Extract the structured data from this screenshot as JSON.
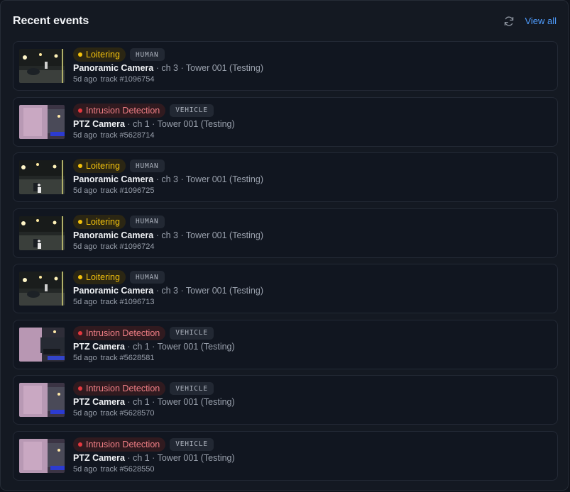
{
  "header": {
    "title": "Recent events",
    "view_all_label": "View all",
    "refresh_icon": "refresh-icon"
  },
  "colors": {
    "loitering": "#f4c20d",
    "intrusion": "#e5383f",
    "link": "#4f9dff"
  },
  "separator": " · ",
  "events": [
    {
      "type": "loiter",
      "event": "Loitering",
      "class": "HUMAN",
      "camera": "Panoramic Camera",
      "channel": "ch 3",
      "site": "Tower 001 (Testing)",
      "time": "5d ago",
      "track": "track #1096754",
      "thumb": "night-car"
    },
    {
      "type": "intrusion",
      "event": "Intrusion Detection",
      "class": "VEHICLE",
      "camera": "PTZ Camera",
      "channel": "ch 1",
      "site": "Tower 001 (Testing)",
      "time": "5d ago",
      "track": "track #5628714",
      "thumb": "ptz-pink"
    },
    {
      "type": "loiter",
      "event": "Loitering",
      "class": "HUMAN",
      "camera": "Panoramic Camera",
      "channel": "ch 3",
      "site": "Tower 001 (Testing)",
      "time": "5d ago",
      "track": "track #1096725",
      "thumb": "night-person"
    },
    {
      "type": "loiter",
      "event": "Loitering",
      "class": "HUMAN",
      "camera": "Panoramic Camera",
      "channel": "ch 3",
      "site": "Tower 001 (Testing)",
      "time": "5d ago",
      "track": "track #1096724",
      "thumb": "night-person"
    },
    {
      "type": "loiter",
      "event": "Loitering",
      "class": "HUMAN",
      "camera": "Panoramic Camera",
      "channel": "ch 3",
      "site": "Tower 001 (Testing)",
      "time": "5d ago",
      "track": "track #1096713",
      "thumb": "night-car"
    },
    {
      "type": "intrusion",
      "event": "Intrusion Detection",
      "class": "VEHICLE",
      "camera": "PTZ Camera",
      "channel": "ch 1",
      "site": "Tower 001 (Testing)",
      "time": "5d ago",
      "track": "track #5628581",
      "thumb": "ptz-car"
    },
    {
      "type": "intrusion",
      "event": "Intrusion Detection",
      "class": "VEHICLE",
      "camera": "PTZ Camera",
      "channel": "ch 1",
      "site": "Tower 001 (Testing)",
      "time": "5d ago",
      "track": "track #5628570",
      "thumb": "ptz-pink"
    },
    {
      "type": "intrusion",
      "event": "Intrusion Detection",
      "class": "VEHICLE",
      "camera": "PTZ Camera",
      "channel": "ch 1",
      "site": "Tower 001 (Testing)",
      "time": "5d ago",
      "track": "track #5628550",
      "thumb": "ptz-pink"
    }
  ]
}
